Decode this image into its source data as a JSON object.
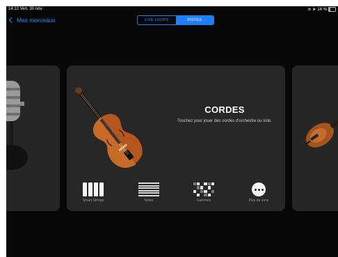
{
  "status": {
    "time": "14:12",
    "date": "Ven. 30 nov.",
    "battery": "14 %"
  },
  "nav": {
    "back_label": "Mes morceaux",
    "segments": [
      "LIVE LOOPS",
      "PISTES"
    ],
    "selected_segment": "PISTES"
  },
  "instrument": {
    "title": "CORDES",
    "description": "Touchez pour jouer des cordes d'orchestre ou solo."
  },
  "modes": [
    {
      "label": "Smart Strings",
      "icon": "strings-icon"
    },
    {
      "label": "Notes",
      "icon": "notes-icon"
    },
    {
      "label": "Gammes",
      "icon": "scales-icon"
    },
    {
      "label": "Plus de sons",
      "icon": "more-icon"
    }
  ],
  "colors": {
    "accent": "#1f7fff",
    "card": "#272727",
    "background": "#080808"
  }
}
